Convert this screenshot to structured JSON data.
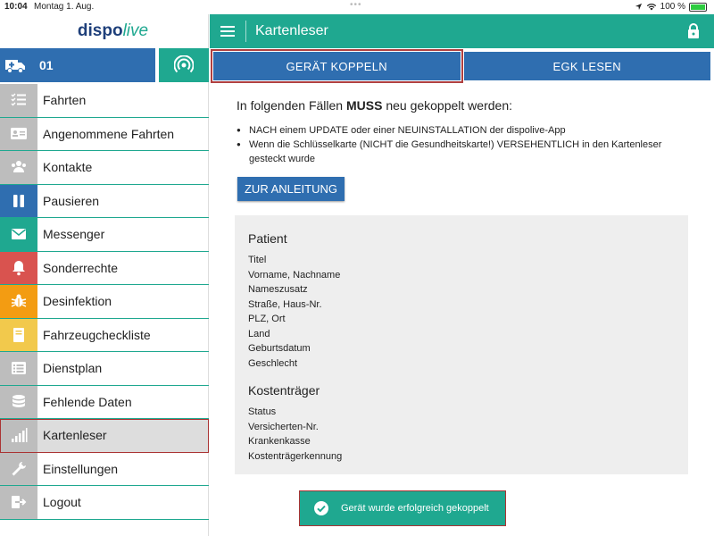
{
  "statusbar": {
    "time": "10:04",
    "date": "Montag 1. Aug.",
    "battery": "100 %"
  },
  "sidebar": {
    "logo_a": "dispo",
    "logo_b": "live",
    "vehicle_number": "01",
    "items": [
      {
        "label": "Fahrten",
        "icon": "list-check-icon",
        "color": "#bdbdbd"
      },
      {
        "label": "Angenommene Fahrten",
        "icon": "id-card-icon",
        "color": "#bdbdbd"
      },
      {
        "label": "Kontakte",
        "icon": "people-icon",
        "color": "#bdbdbd"
      },
      {
        "label": "Pausieren",
        "icon": "pause-icon",
        "color": "#2f6eb0"
      },
      {
        "label": "Messenger",
        "icon": "envelope-icon",
        "color": "#1fa890"
      },
      {
        "label": "Sonderrechte",
        "icon": "bell-icon",
        "color": "#d9534f"
      },
      {
        "label": "Desinfektion",
        "icon": "bug-icon",
        "color": "#f39c12"
      },
      {
        "label": "Fahrzeugcheckliste",
        "icon": "book-icon",
        "color": "#f2c94c"
      },
      {
        "label": "Dienstplan",
        "icon": "list-icon",
        "color": "#bdbdbd"
      },
      {
        "label": "Fehlende Daten",
        "icon": "database-icon",
        "color": "#bdbdbd"
      },
      {
        "label": "Kartenleser",
        "icon": "signal-icon",
        "color": "#bdbdbd"
      },
      {
        "label": "Einstellungen",
        "icon": "wrench-icon",
        "color": "#bdbdbd"
      },
      {
        "label": "Logout",
        "icon": "logout-icon",
        "color": "#bdbdbd"
      }
    ]
  },
  "header": {
    "title": "Kartenleser"
  },
  "actions": {
    "pair": "GERÄT KOPPELN",
    "read": "EGK LESEN"
  },
  "content": {
    "heading_pre": "In folgenden Fällen ",
    "heading_bold": "MUSS",
    "heading_post": " neu gekoppelt werden:",
    "bullets": [
      "NACH einem UPDATE oder einer NEUINSTALLATION der dispolive-App",
      "Wenn die Schlüsselkarte (NICHT die Gesundheitskarte!) VERSEHENTLICH in den Kartenleser gesteckt wurde"
    ],
    "guide_button": "ZUR ANLEITUNG",
    "patient_title": "Patient",
    "patient_fields": [
      "Titel",
      "Vorname, Nachname",
      "Nameszusatz",
      "Straße, Haus-Nr.",
      "PLZ, Ort",
      "Land",
      "Geburtsdatum",
      "Geschlecht"
    ],
    "kosten_title": "Kostenträger",
    "kosten_fields": [
      "Status",
      "Versicherten-Nr.",
      "Krankenkasse",
      "Kostenträgerkennung"
    ]
  },
  "toast": {
    "message": "Gerät wurde erfolgreich gekoppelt"
  },
  "colors": {
    "teal": "#1fa890",
    "blue": "#2f6eb0",
    "navy": "#1e3f7a"
  }
}
